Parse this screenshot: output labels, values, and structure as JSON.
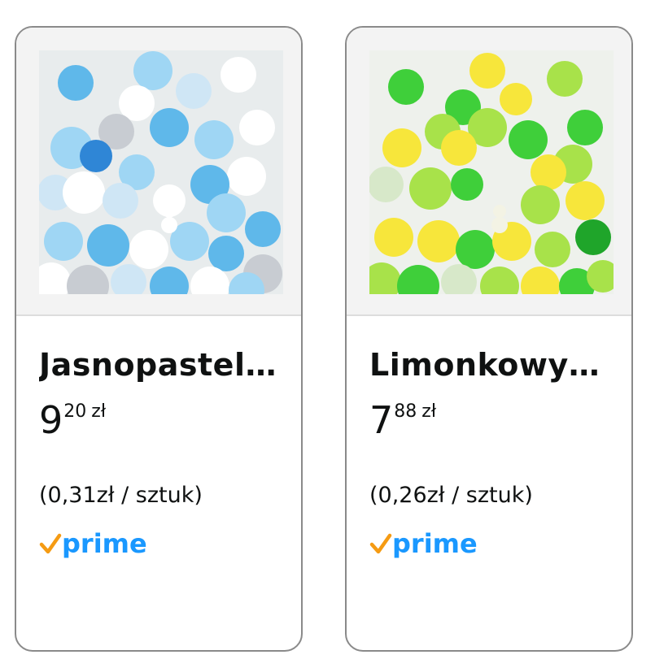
{
  "products": [
    {
      "title": "Jasnopastel…",
      "price_whole": "9",
      "price_fraction": "20",
      "currency": "zł",
      "unit_price": "(0,31zł / sztuk)",
      "badge": "prime",
      "palette": [
        "#5fb8ea",
        "#9fd6f4",
        "#ffffff",
        "#c8ccd2",
        "#2f86d6"
      ]
    },
    {
      "title": "Limonkowy…",
      "price_whole": "7",
      "price_fraction": "88",
      "currency": "zł",
      "unit_price": "(0,26zł / sztuk)",
      "badge": "prime",
      "palette": [
        "#3fcf3a",
        "#a8e24a",
        "#f7e63b",
        "#d7e8c9",
        "#1fa52a"
      ]
    }
  ],
  "colors": {
    "prime_blue": "#1a98ff",
    "prime_check": "#f59b13",
    "text": "#0f1111",
    "card_border": "#8a8a8a"
  }
}
